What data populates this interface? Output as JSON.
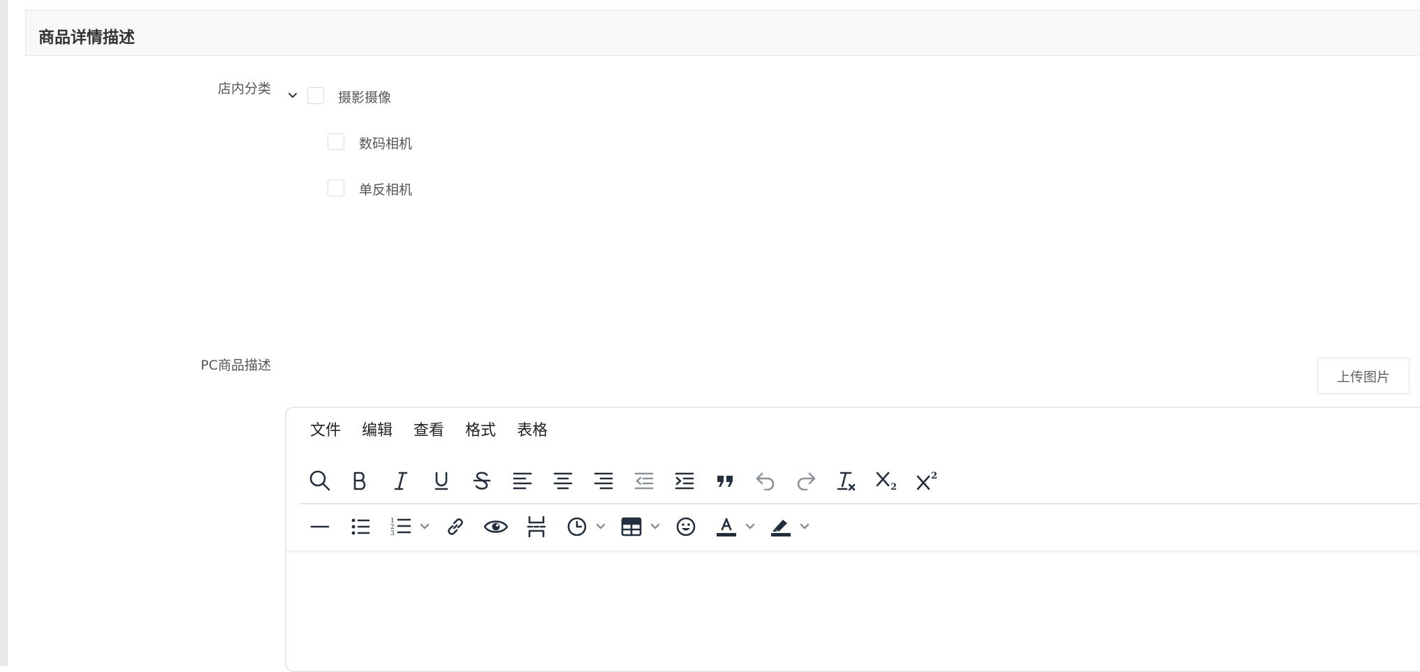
{
  "section": {
    "title": "商品详情描述"
  },
  "form": {
    "category_label": "店内分类",
    "pc_desc_label": "PC商品描述"
  },
  "category_tree": {
    "parent": {
      "label": "摄影摄像",
      "checked": false,
      "expanded": true
    },
    "children": [
      {
        "label": "数码相机",
        "checked": false
      },
      {
        "label": "单反相机",
        "checked": false
      }
    ]
  },
  "upload_button": {
    "label": "上传图片"
  },
  "editor": {
    "menubar": [
      "文件",
      "编辑",
      "查看",
      "格式",
      "表格"
    ],
    "toolbar_row1": [
      "search-icon",
      "bold-icon",
      "italic-icon",
      "underline-icon",
      "strikethrough-icon",
      "align-left-icon",
      "align-center-icon",
      "align-right-icon",
      "outdent-icon",
      "indent-icon",
      "blockquote-icon",
      "undo-icon",
      "redo-icon",
      "clear-format-icon",
      "subscript-icon",
      "superscript-icon"
    ],
    "toolbar_row2": [
      "horizontal-rule-icon",
      "bullet-list-icon",
      "numbered-list-icon",
      "link-icon",
      "preview-icon",
      "page-break-icon",
      "insert-time-icon",
      "table-icon",
      "emoticons-icon",
      "text-color-icon",
      "highlight-color-icon"
    ],
    "text_color": "#000000",
    "highlight_color": "#000000",
    "content": ""
  }
}
